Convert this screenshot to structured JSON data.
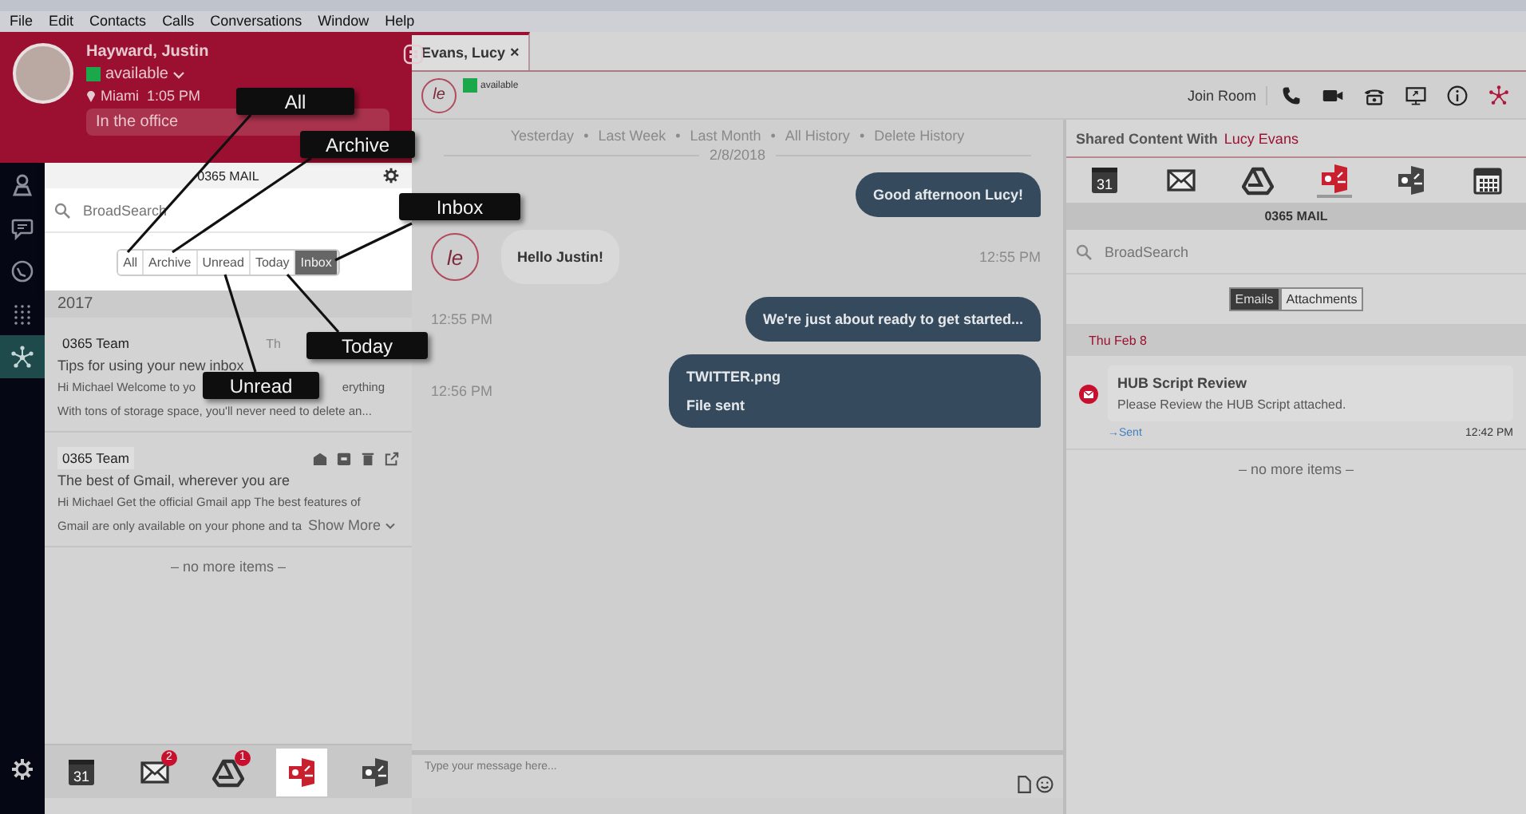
{
  "menu": [
    "File",
    "Edit",
    "Contacts",
    "Calls",
    "Conversations",
    "Window",
    "Help"
  ],
  "profile": {
    "name": "Hayward, Justin",
    "status": "available",
    "location": "Miami",
    "time": "1:05 PM",
    "note": "In the office"
  },
  "rail": [
    {
      "kind": "contact",
      "selected": false
    },
    {
      "kind": "chat",
      "selected": false
    },
    {
      "kind": "history",
      "selected": false
    },
    {
      "kind": "dialpad",
      "selected": false
    },
    {
      "kind": "hub",
      "selected": true
    }
  ],
  "mail_panel": {
    "title": "0365 MAIL",
    "search_placeholder": "BroadSearch",
    "filters": [
      {
        "label": "All",
        "selected": false
      },
      {
        "label": "Archive",
        "selected": false
      },
      {
        "label": "Unread",
        "selected": false
      },
      {
        "label": "Today",
        "selected": false
      },
      {
        "label": "Inbox",
        "selected": true
      }
    ],
    "group": "2017",
    "emails": [
      {
        "sender": "0365 Team",
        "date": "Th",
        "subject": "Tips for using your new inbox",
        "preview": [
          [
            "Hi Michael Welcome to yo",
            "erything"
          ],
          [
            "With tons of storage space, you'll never need to delete an..."
          ]
        ],
        "hovered": false
      },
      {
        "sender": "0365 Team",
        "subject": "The best of Gmail, wherever you are",
        "preview": [
          [
            "Hi Michael Get the official Gmail app The best features of"
          ],
          [
            "Gmail are only available on your phone and ta"
          ]
        ],
        "show_more": "Show More",
        "hovered": true
      }
    ],
    "end_note": "– no more items –"
  },
  "dock": [
    {
      "kind": "calendar",
      "label": "31",
      "selected": false
    },
    {
      "kind": "mail",
      "badge": "2",
      "selected": false
    },
    {
      "kind": "drive",
      "badge": "1",
      "selected": false
    },
    {
      "kind": "office",
      "selected": true
    },
    {
      "kind": "outlook",
      "selected": false
    }
  ],
  "annotations": [
    {
      "label": "All"
    },
    {
      "label": "Archive"
    },
    {
      "label": "Inbox"
    },
    {
      "label": "Today"
    },
    {
      "label": "Unread"
    }
  ],
  "conversation": {
    "tab": {
      "label": "Evans, Lucy",
      "close": "×",
      "selected": true
    },
    "contact": {
      "initials": "le",
      "status": "available"
    },
    "join_room": "Join Room",
    "history_links": [
      "Yesterday",
      "Last Week",
      "Last Month",
      "All History",
      "Delete History"
    ],
    "separator": "•",
    "date": "2/8/2018",
    "messages": [
      {
        "kind": "outgoing",
        "text": [
          "Good afternoon Lucy!"
        ]
      },
      {
        "kind": "incoming",
        "avatar": "le",
        "text": [
          "Hello Justin!"
        ],
        "time": "12:55 PM"
      },
      {
        "kind": "outgoing",
        "time": "12:55 PM",
        "text": [
          "We're just about ready to get started..."
        ]
      },
      {
        "kind": "outgoing",
        "time": "12:56 PM",
        "text": [
          "TWITTER.png",
          "File sent"
        ]
      }
    ],
    "input_placeholder": "Type your message here..."
  },
  "shared": {
    "title": "Shared Content With",
    "contact": "Lucy Evans",
    "apps": [
      {
        "kind": "calendar",
        "label": "31",
        "selected": false
      },
      {
        "kind": "mail",
        "selected": false
      },
      {
        "kind": "drive",
        "selected": false
      },
      {
        "kind": "office",
        "selected": true
      },
      {
        "kind": "outlook",
        "selected": false
      },
      {
        "kind": "planner",
        "selected": false
      }
    ],
    "section": "0365 MAIL",
    "search_placeholder": "BroadSearch",
    "tabs": [
      {
        "label": "Emails",
        "selected": true
      },
      {
        "label": "Attachments",
        "selected": false
      }
    ],
    "group": "Thu Feb 8",
    "emails": [
      {
        "subject": "HUB Script Review",
        "body": "Please Review the HUB Script attached.",
        "status": "→Sent",
        "time": "12:42 PM"
      }
    ],
    "end_note": "– no more items –"
  }
}
